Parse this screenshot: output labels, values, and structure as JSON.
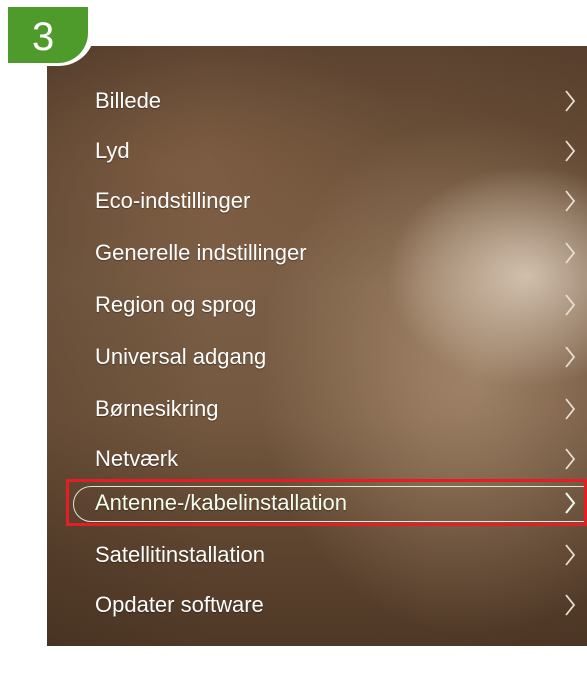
{
  "step_badge": {
    "number": "3",
    "color": "#4e9b2c"
  },
  "highlight_color": "#e31e24",
  "menu": {
    "items": [
      {
        "label": "Billede",
        "selected": false
      },
      {
        "label": "Lyd",
        "selected": false
      },
      {
        "label": "Eco-indstillinger",
        "selected": false
      },
      {
        "label": "Generelle indstillinger",
        "selected": false
      },
      {
        "label": "Region og sprog",
        "selected": false
      },
      {
        "label": "Universal adgang",
        "selected": false
      },
      {
        "label": "Børnesikring",
        "selected": false
      },
      {
        "label": "Netværk",
        "selected": false
      },
      {
        "label": "Antenne-/kabelinstallation",
        "selected": true
      },
      {
        "label": "Satellitinstallation",
        "selected": false
      },
      {
        "label": "Opdater software",
        "selected": false
      }
    ],
    "chevron_icon": "chevron-right-icon"
  }
}
